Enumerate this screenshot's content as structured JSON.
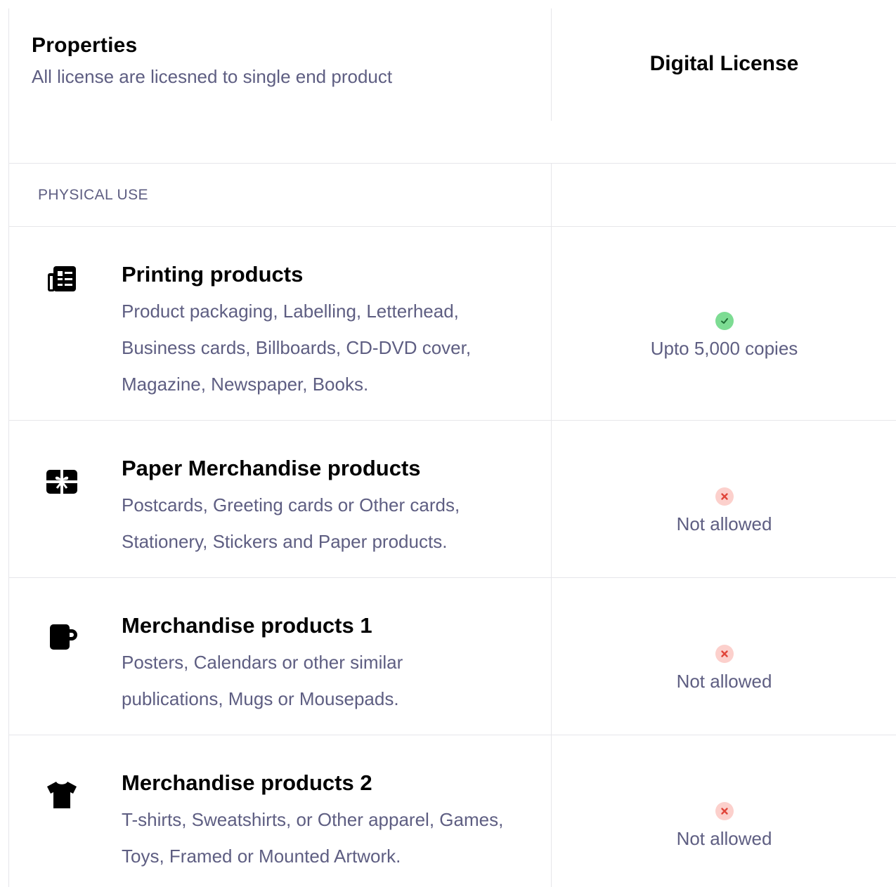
{
  "header": {
    "title": "Properties",
    "subtitle": "All license are licesned to single end product",
    "license_column": "Digital License"
  },
  "section": {
    "label": "PHYSICAL USE"
  },
  "rows": [
    {
      "icon": "newspaper-icon",
      "title": "Printing products",
      "desc_lines": [
        "Product packaging, Labelling, Letterhead,",
        "Business cards, Billboards, CD-DVD cover,",
        "Magazine, Newspaper, Books."
      ],
      "status": "allowed",
      "status_text": "Upto 5,000 copies"
    },
    {
      "icon": "gift-card-icon",
      "title": "Paper Merchandise products",
      "desc_lines": [
        "Postcards, Greeting cards or Other cards,",
        "Stationery, Stickers and Paper products."
      ],
      "status": "not-allowed",
      "status_text": "Not allowed"
    },
    {
      "icon": "mug-icon",
      "title": "Merchandise products 1",
      "desc_lines": [
        "Posters, Calendars or other similar",
        "publications, Mugs or Mousepads."
      ],
      "status": "not-allowed",
      "status_text": "Not allowed"
    },
    {
      "icon": "tshirt-icon",
      "title": "Merchandise products 2",
      "desc_lines": [
        "T-shirts, Sweatshirts, or Other apparel, Games,",
        "Toys, Framed or Mounted Artwork."
      ],
      "status": "not-allowed",
      "status_text": "Not allowed"
    }
  ],
  "colors": {
    "muted_text": "#5e5e82",
    "border": "#e6e6ea",
    "ok_badge": "#7ddc93",
    "no_badge": "#fcd0cc",
    "no_mark": "#e0453a",
    "ok_mark": "#1e6b34"
  }
}
